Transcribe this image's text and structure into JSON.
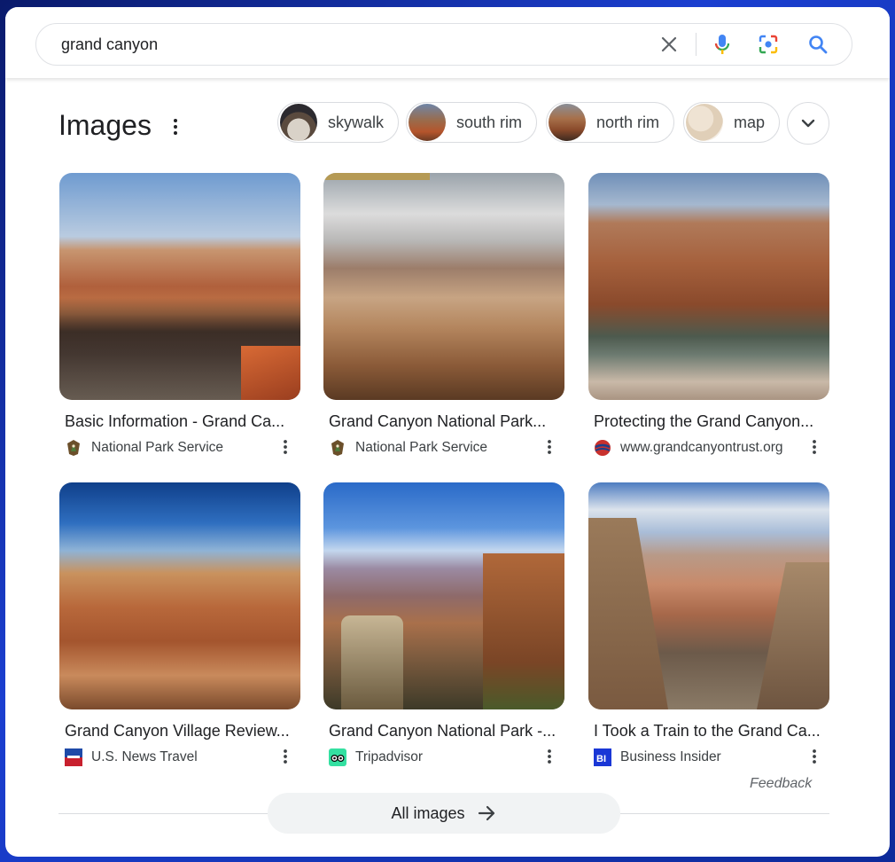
{
  "search": {
    "query": "grand canyon"
  },
  "images_section": {
    "title": "Images",
    "chips": [
      {
        "label": "skywalk"
      },
      {
        "label": "south rim"
      },
      {
        "label": "north rim"
      },
      {
        "label": "map"
      }
    ]
  },
  "results": [
    {
      "caption": "Basic Information - Grand Ca...",
      "source": "National Park Service",
      "favicon": "nps-arrowhead-icon"
    },
    {
      "caption": "Grand Canyon National Park...",
      "source": "National Park Service",
      "favicon": "nps-arrowhead-icon"
    },
    {
      "caption": "Protecting the Grand Canyon...",
      "source": "www.grandcanyontrust.org",
      "favicon": "trust-logo-icon"
    },
    {
      "caption": "Grand Canyon Village Review...",
      "source": "U.S. News Travel",
      "favicon": "usnews-icon"
    },
    {
      "caption": "Grand Canyon National Park -...",
      "source": "Tripadvisor",
      "favicon": "tripadvisor-owl-icon"
    },
    {
      "caption": "I Took a Train to the Grand Ca...",
      "source": "Business Insider",
      "favicon": "business-insider-icon"
    }
  ],
  "feedback_label": "Feedback",
  "all_images_label": "All images",
  "colors": {
    "accent_blue": "#4285f4",
    "mic_red": "#ea4335"
  }
}
